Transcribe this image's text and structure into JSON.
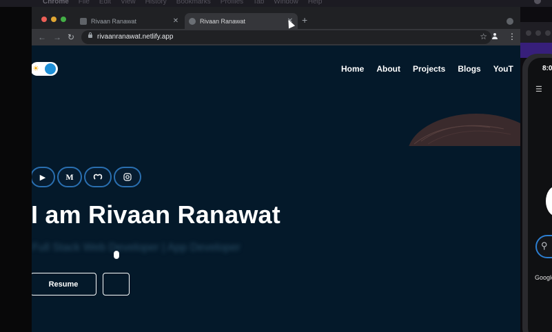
{
  "menubar": {
    "items": [
      "Chrome",
      "File",
      "Edit",
      "View",
      "History",
      "Bookmarks",
      "Profiles",
      "Tab",
      "Window",
      "Help"
    ]
  },
  "browser": {
    "tabs": [
      {
        "title": "Rivaan Ranawat",
        "active": false
      },
      {
        "title": "Rivaan Ranawat",
        "active": true
      }
    ],
    "new_tab_label": "+",
    "url": "rivaanranawat.netlify.app"
  },
  "page": {
    "nav": [
      "Home",
      "About",
      "Projects",
      "Blogs",
      "YouT"
    ],
    "socials": [
      "play-store-icon",
      "medium-icon",
      "github-icon",
      "instagram-icon"
    ],
    "medium_label": "M",
    "hero_title": "I am Rivaan Ranawat",
    "subtitle": "Full Stack Web Developer | App Developer",
    "buttons": {
      "resume": "Resume"
    },
    "toggle_state": "dark"
  },
  "phone": {
    "time": "8:0",
    "label": "Google"
  },
  "colors": {
    "page_bg": "#04192a",
    "accent_blue": "#1e8fd6",
    "social_border": "#2a6fb0",
    "purple_strip": "#371f7a"
  }
}
